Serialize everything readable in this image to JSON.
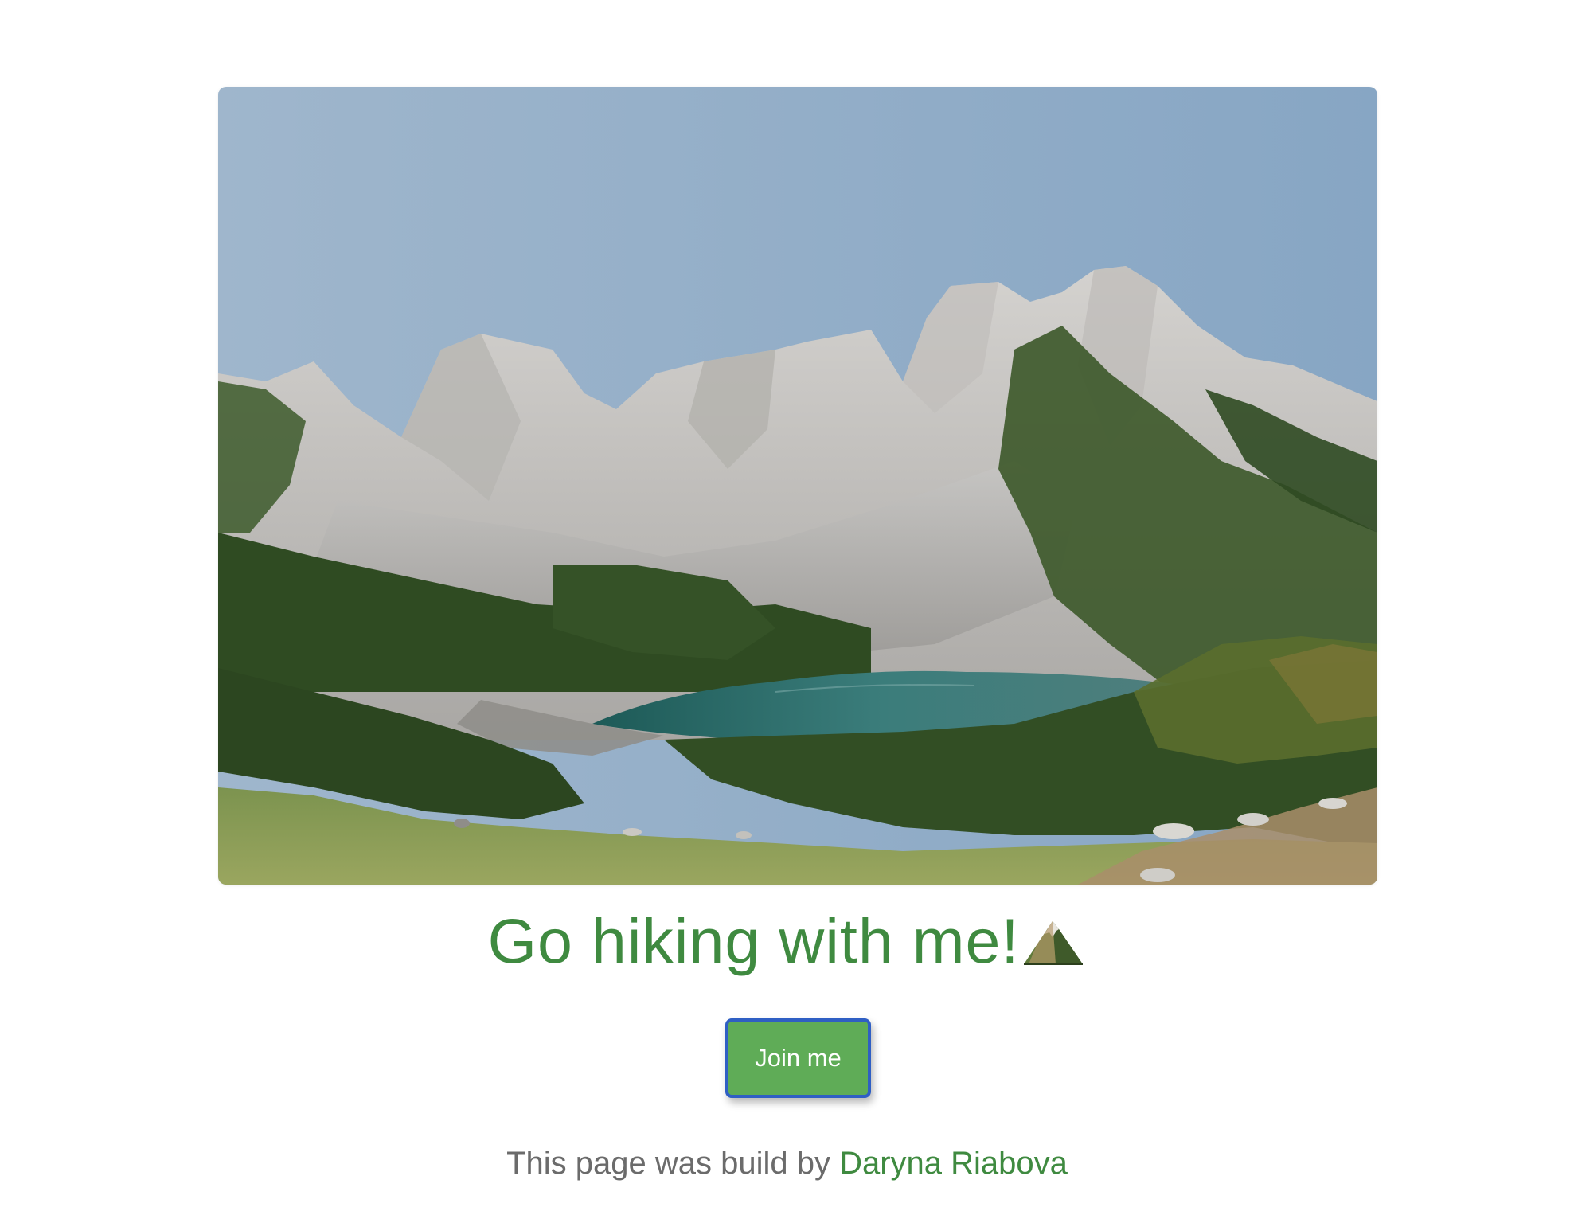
{
  "hero": {
    "image_subject": "mountain lake landscape"
  },
  "heading": {
    "text": "Go hiking with me!",
    "emoji_icon": "mountain-icon"
  },
  "cta": {
    "label": "Join me"
  },
  "footer": {
    "prefix": "This page was build by ",
    "author": "Daryna Riabova"
  },
  "colors": {
    "accent_green": "#3f8a40",
    "button_green": "#5fac57",
    "button_border": "#2f5fc4",
    "muted_text": "#6b6b6b"
  }
}
